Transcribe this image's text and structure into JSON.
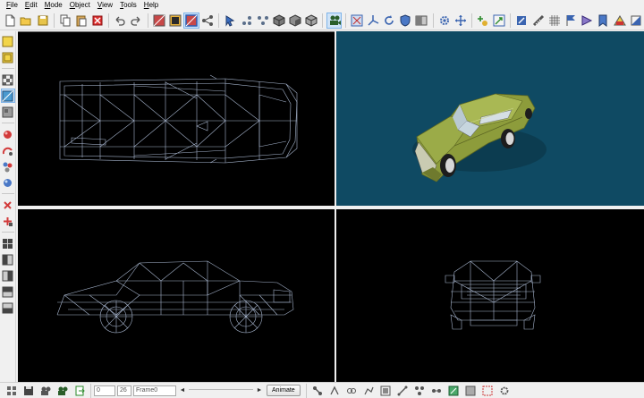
{
  "menu": [
    {
      "label": "File",
      "accel": "F"
    },
    {
      "label": "Edit",
      "accel": "E"
    },
    {
      "label": "Mode",
      "accel": "M"
    },
    {
      "label": "Object",
      "accel": "O"
    },
    {
      "label": "View",
      "accel": "V"
    },
    {
      "label": "Tools",
      "accel": "T"
    },
    {
      "label": "Help",
      "accel": "H"
    }
  ],
  "toolbar": {
    "groups": [
      [
        "new-file-icon",
        "open-folder-icon",
        "save-icon"
      ],
      [
        "copy-icon",
        "paste-icon",
        "delete-icon"
      ],
      [
        "undo-icon",
        "redo-icon"
      ],
      [
        "select-face-icon",
        "select-vertex-icon",
        "select-edge-icon",
        "connect-icon"
      ],
      [
        "select-pointer-icon",
        "vertices-icon",
        "vertices-alt-icon",
        "cube-solid-icon",
        "cube-shaded-icon",
        "cube-gray-icon"
      ],
      [
        "camera-icon"
      ],
      [
        "scale-icon",
        "axis-icon",
        "rotate-icon",
        "shield-icon",
        "split-icon"
      ],
      [
        "gear-icon",
        "move-icon"
      ],
      [
        "add-point-icon",
        "extrude-icon"
      ],
      [
        "pen-icon",
        "ruler-icon",
        "grid-icon",
        "flag-icon",
        "triangle-icon",
        "bookmark-icon",
        "palette-icon",
        "paint-icon"
      ]
    ],
    "active": "select-edge-icon"
  },
  "left_toolbar": {
    "groups": [
      [
        "yellow-box-icon",
        "yellow-box-alt-icon"
      ],
      [
        "checker-icon",
        "texture-icon",
        "gray-texture-icon"
      ],
      [
        "red-sphere-icon",
        "red-arc-icon",
        "sphere-group-icon",
        "ball-icon"
      ],
      [
        "red-cross-icon",
        "red-plus-icon"
      ],
      [
        "layout-quad-icon",
        "layout-left-icon",
        "layout-right-icon",
        "layout-top-icon",
        "layout-bottom-icon"
      ]
    ],
    "active": "texture-icon"
  },
  "viewports": {
    "top": "top-view",
    "perspective": "perspective-view",
    "side": "side-view",
    "front": "front-view",
    "colors": {
      "wire": "#b9c9e4",
      "persp_bg": "#0f4a63",
      "car_body": "#8d9c3b"
    }
  },
  "status": {
    "frame_start": "0",
    "frame_end": "26",
    "frame_name": "Frame0",
    "animate_label": "Animate"
  }
}
